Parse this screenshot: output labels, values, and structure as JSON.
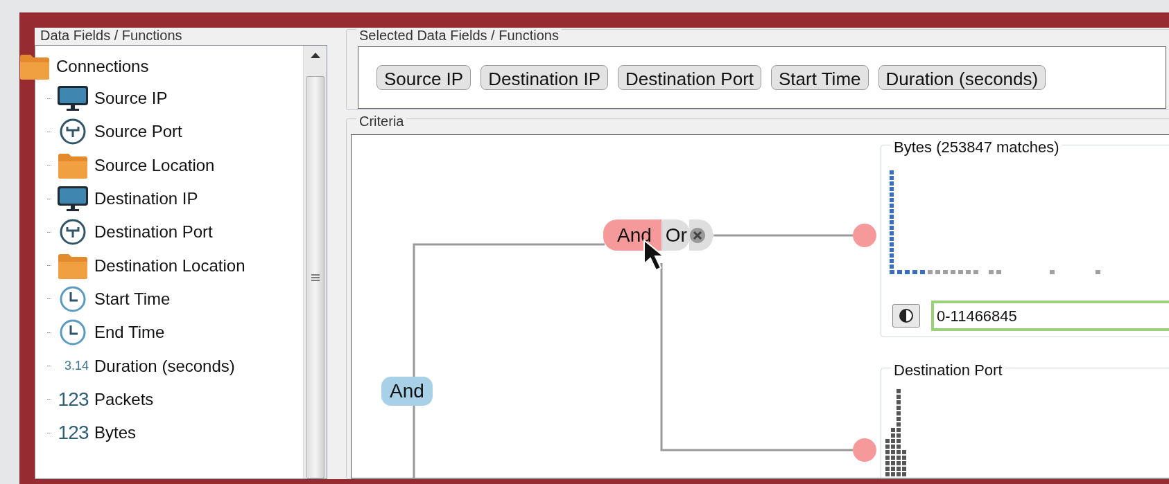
{
  "fields_panel": {
    "heading": "Data Fields / Functions",
    "tree": [
      {
        "label": "Connections",
        "kind": "folder",
        "children": [
          {
            "label": "Source IP",
            "kind": "monitor"
          },
          {
            "label": "Source Port",
            "kind": "port"
          },
          {
            "label": "Source Location",
            "kind": "folder"
          },
          {
            "label": "Destination IP",
            "kind": "monitor"
          },
          {
            "label": "Destination Port",
            "kind": "port"
          },
          {
            "label": "Destination Location",
            "kind": "folder"
          },
          {
            "label": "Start Time",
            "kind": "clock"
          },
          {
            "label": "End Time",
            "kind": "clock"
          },
          {
            "label": "Duration (seconds)",
            "kind": "decimal",
            "badge": "3.14"
          },
          {
            "label": "Packets",
            "kind": "integer",
            "badge": "123"
          },
          {
            "label": "Bytes",
            "kind": "integer",
            "badge": "123"
          }
        ]
      }
    ]
  },
  "selected_panel": {
    "heading": "Selected Data Fields / Functions",
    "chips": [
      "Source IP",
      "Destination IP",
      "Destination Port",
      "Start Time",
      "Duration (seconds)"
    ]
  },
  "criteria": {
    "heading": "Criteria",
    "root_operator": "And",
    "operator_toggle": [
      {
        "label": "And",
        "selected": true
      },
      {
        "label": "Or",
        "selected": false
      }
    ],
    "filters": [
      {
        "title": "Bytes (253847 matches)",
        "kind": "range",
        "range": "0-11466845"
      },
      {
        "title": "Destination Port",
        "kind": "histogram"
      }
    ]
  }
}
